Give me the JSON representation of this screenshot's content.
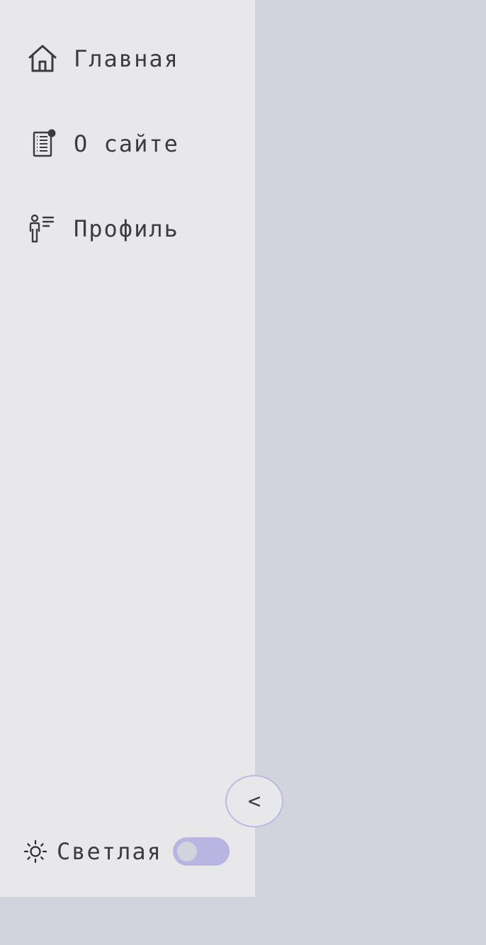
{
  "sidebar": {
    "items": [
      {
        "label": "Главная",
        "icon": "home-icon"
      },
      {
        "label": "О сайте",
        "icon": "document-icon"
      },
      {
        "label": "Профиль",
        "icon": "profile-list-icon"
      }
    ],
    "collapse_label": "<",
    "theme": {
      "label": "Светлая",
      "icon": "sun-icon",
      "toggle_on": false
    }
  },
  "colors": {
    "sidebar_bg": "#e8e8ea",
    "page_bg": "#d2d4dd",
    "accent": "#b8b5e3",
    "text": "#3c3c3e"
  }
}
